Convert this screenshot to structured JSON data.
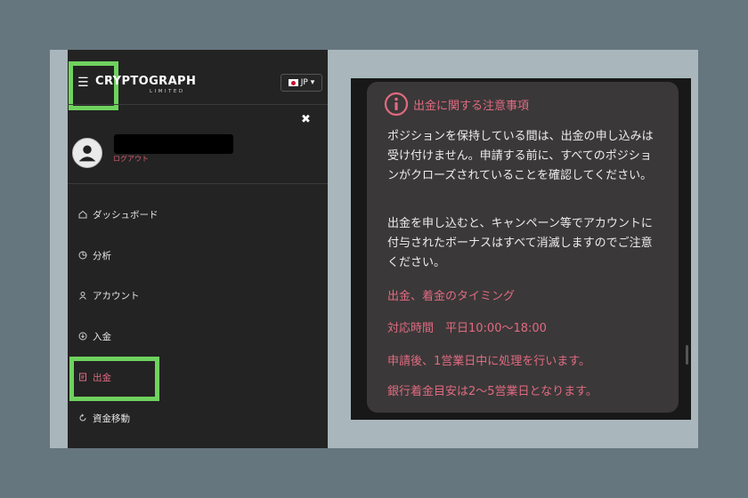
{
  "header": {
    "logo_main": "CRYPTOGRAPH",
    "logo_sub": "LIMITED",
    "language": "JP",
    "language_caret": "▾",
    "menu_icon": "hamburger-icon",
    "close_icon": "close-icon"
  },
  "profile": {
    "logout": "ログアウト",
    "avatar_icon": "user-icon"
  },
  "nav": [
    {
      "label": "ダッシュボード",
      "icon": "home-icon"
    },
    {
      "label": "分析",
      "icon": "chart-icon"
    },
    {
      "label": "アカウント",
      "icon": "user-icon"
    },
    {
      "label": "入金",
      "icon": "deposit-icon"
    },
    {
      "label": "出金",
      "icon": "withdraw-icon",
      "active": true
    },
    {
      "label": "資金移動",
      "icon": "transfer-icon"
    }
  ],
  "notice": {
    "title": "出金に関する注意事項",
    "icon": "info-icon",
    "paragraphs": [
      "ポジションを保持している間は、出金の申し込みは受け付けません。申請する前に、すべてのポジションがクローズされていることを確認してください。",
      "出金を申し込むと、キャンペーン等でアカウントに付与されたボーナスはすべて消滅しますのでご注意ください。"
    ],
    "timing_heading": "出金、着金のタイミング",
    "hours": "対応時間　平日10:00〜18:00",
    "processing": "申請後、1営業日中に処理を行います。",
    "bank_arrival": "銀行着金目安は2〜5営業日となります。"
  },
  "colors": {
    "accent_pink": "#e06b80",
    "highlight_green": "#6fd25f",
    "sidebar_bg": "#232323",
    "card_bg": "#3b3839"
  }
}
